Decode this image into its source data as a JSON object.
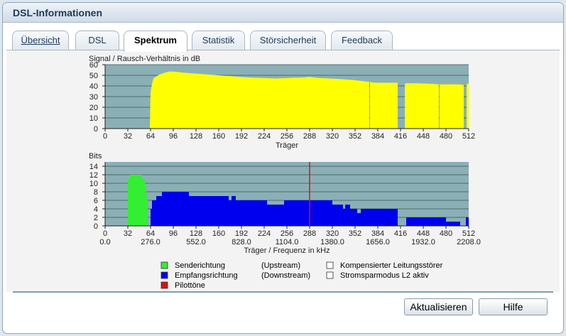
{
  "window": {
    "title": "DSL-Informationen"
  },
  "tabs": [
    {
      "label": "Übersicht",
      "active": false
    },
    {
      "label": "DSL",
      "active": false
    },
    {
      "label": "Spektrum",
      "active": true
    },
    {
      "label": "Statistik",
      "active": false
    },
    {
      "label": "Störsicherheit",
      "active": false
    },
    {
      "label": "Feedback",
      "active": false
    }
  ],
  "chart_data": [
    {
      "type": "area",
      "ylabel": "Signal / Rausch-Verhältnis in dB",
      "xlabel": "Träger",
      "ylim": [
        0,
        60
      ],
      "xlim": [
        0,
        512
      ],
      "yticks": [
        0,
        10,
        20,
        30,
        40,
        50,
        60
      ],
      "xticks": [
        0,
        32,
        64,
        96,
        128,
        160,
        192,
        224,
        256,
        288,
        320,
        352,
        384,
        416,
        448,
        480,
        512
      ],
      "series": [
        {
          "name": "",
          "color": "#ffff00",
          "segments": [
            {
              "x": [
                63,
                64,
                66,
                68,
                72,
                76,
                80,
                84,
                90,
                96,
                110,
                130,
                160,
                200,
                240,
                280,
                288,
                300,
                330,
                350,
                370,
                372
              ],
              "y": [
                0,
                34,
                42,
                47,
                49,
                50.5,
                51.5,
                52.5,
                53.5,
                53.5,
                52.5,
                51.5,
                50,
                48,
                47,
                48,
                48.5,
                47.5,
                46.5,
                45.5,
                44,
                44
              ]
            },
            {
              "x": [
                373,
                375,
                380,
                400,
                412
              ],
              "y": [
                44,
                43.5,
                43,
                43,
                43
              ]
            },
            {
              "x": [
                422,
                424,
                440,
                460,
                470
              ],
              "y": [
                42,
                42.5,
                42.5,
                42,
                41.5
              ]
            },
            {
              "x": [
                471,
                480,
                500,
                505
              ],
              "y": [
                41.5,
                41.5,
                41.5,
                41
              ]
            },
            {
              "x": [
                509,
                512
              ],
              "y": [
                42,
                42
              ]
            }
          ]
        }
      ],
      "grid": true,
      "plot_bg": "#8ab0b6"
    },
    {
      "type": "area",
      "ylabel": "Bits",
      "xlabel": "Träger / Frequenz in kHz",
      "ylim": [
        0,
        15
      ],
      "xlim": [
        0,
        512
      ],
      "yticks": [
        0,
        2,
        4,
        6,
        8,
        10,
        12,
        14
      ],
      "xticks": [
        0,
        32,
        64,
        96,
        128,
        160,
        192,
        224,
        256,
        288,
        320,
        352,
        384,
        416,
        448,
        480,
        512
      ],
      "freq_ticks": [
        {
          "x": 0,
          "label": "0.0"
        },
        {
          "x": 64,
          "label": "276.0"
        },
        {
          "x": 128,
          "label": "552.0"
        },
        {
          "x": 192,
          "label": "828.0"
        },
        {
          "x": 256,
          "label": "1104.0"
        },
        {
          "x": 320,
          "label": "1380.0"
        },
        {
          "x": 384,
          "label": "1656.0"
        },
        {
          "x": 448,
          "label": "1932.0"
        },
        {
          "x": 512,
          "label": "2208.0"
        }
      ],
      "series": [
        {
          "name": "Senderichtung",
          "color": "#33ee33",
          "steps": [
            [
              32,
              35,
              11
            ],
            [
              35,
              40,
              12
            ],
            [
              40,
              52,
              12
            ],
            [
              52,
              56,
              11
            ],
            [
              56,
              58,
              9
            ],
            [
              58,
              60,
              7
            ]
          ]
        },
        {
          "name": "Empfangsrichtung",
          "color": "#0000ee",
          "steps": [
            [
              64,
              66,
              4
            ],
            [
              66,
              72,
              6
            ],
            [
              72,
              80,
              7
            ],
            [
              80,
              96,
              8
            ],
            [
              96,
              118,
              8
            ],
            [
              118,
              174,
              7
            ],
            [
              174,
              178,
              6
            ],
            [
              178,
              184,
              7
            ],
            [
              184,
              228,
              6
            ],
            [
              228,
              252,
              5
            ],
            [
              252,
              264,
              6
            ],
            [
              264,
              310,
              6
            ],
            [
              310,
              320,
              6
            ],
            [
              320,
              326,
              5
            ],
            [
              326,
              335,
              5
            ],
            [
              335,
              338,
              4
            ],
            [
              338,
              345,
              5
            ],
            [
              345,
              355,
              4
            ],
            [
              355,
              360,
              3
            ],
            [
              360,
              370,
              4
            ],
            [
              370,
              388,
              4
            ],
            [
              388,
              412,
              4
            ],
            [
              424,
              432,
              2
            ],
            [
              432,
              448,
              2
            ],
            [
              448,
              480,
              2
            ],
            [
              480,
              500,
              1
            ],
            [
              508,
              512,
              2
            ]
          ]
        }
      ],
      "pilot": {
        "x": 288,
        "color": "#dd1111",
        "name": "Pilottöne"
      },
      "grid": true,
      "plot_bg": "#8ab0b6"
    }
  ],
  "legend": [
    {
      "color": "#33ee33",
      "label": "Senderichtung",
      "direction": "(Upstream)"
    },
    {
      "color": "#0000ee",
      "label": "Empfangsrichtung",
      "direction": "(Downstream)"
    },
    {
      "color": "#dd1111",
      "label": "Pilottöne",
      "direction": ""
    }
  ],
  "legend_right": [
    {
      "color": "#ffffff",
      "label": "Kompensierter Leitungsstörer"
    },
    {
      "color": "#ffffff",
      "label": "Stromsparmodus L2 aktiv"
    }
  ],
  "buttons": {
    "refresh": "Aktualisieren",
    "help": "Hilfe"
  }
}
